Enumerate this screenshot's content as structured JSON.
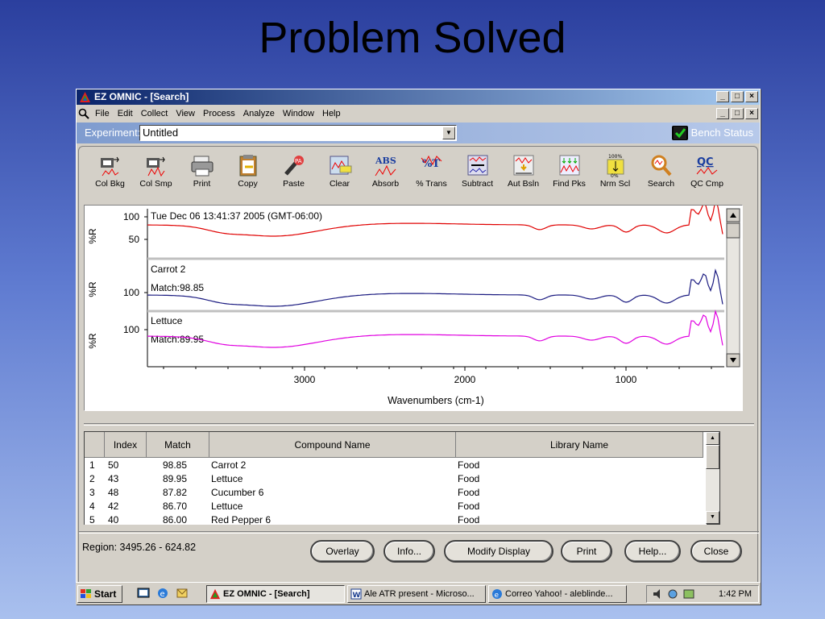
{
  "slide": {
    "title": "Problem Solved"
  },
  "window": {
    "title": "EZ OMNIC - [Search]",
    "buttons": [
      "_",
      "□",
      "×"
    ]
  },
  "menu": {
    "items": [
      "File",
      "Edit",
      "Collect",
      "View",
      "Process",
      "Analyze",
      "Window",
      "Help"
    ]
  },
  "experiment": {
    "label": "Experiment:",
    "value": "Untitled",
    "bench_status": "Bench Status"
  },
  "toolbar": {
    "buttons": [
      "Col Bkg",
      "Col Smp",
      "Print",
      "Copy",
      "Paste",
      "Clear",
      "Absorb",
      "% Trans",
      "Subtract",
      "Aut Bsln",
      "Find Pks",
      "Nrm Scl",
      "Search",
      "QC Cmp"
    ]
  },
  "spectra": {
    "panes": [
      {
        "ylabel": "%R",
        "ticks": [
          "100",
          "50"
        ],
        "title": "Tue Dec 06 13:41:37 2005 (GMT-06:00)",
        "subtitle": "",
        "color": "#e00000"
      },
      {
        "ylabel": "%R",
        "ticks": [
          "100"
        ],
        "title": "Carrot 2",
        "subtitle": "Match:98.85",
        "color": "#1a1a80"
      },
      {
        "ylabel": "%R",
        "ticks": [
          "100"
        ],
        "title": "Lettuce",
        "subtitle": "Match:89.95",
        "color": "#e000e0"
      }
    ],
    "x_ticks": [
      "3000",
      "2000",
      "1000"
    ],
    "x_label": "Wavenumbers (cm-1)"
  },
  "results": {
    "columns": [
      "Index",
      "Match",
      "Compound Name",
      "Library Name"
    ],
    "rows": [
      {
        "n": "1",
        "index": "50",
        "match": "98.85",
        "name": "Carrot 2",
        "library": "Food"
      },
      {
        "n": "2",
        "index": "43",
        "match": "89.95",
        "name": "Lettuce",
        "library": "Food"
      },
      {
        "n": "3",
        "index": "48",
        "match": "87.82",
        "name": "Cucumber 6",
        "library": "Food"
      },
      {
        "n": "4",
        "index": "42",
        "match": "86.70",
        "name": "Lettuce",
        "library": "Food"
      },
      {
        "n": "5",
        "index": "40",
        "match": "86.00",
        "name": "Red Pepper 6",
        "library": "Food"
      }
    ]
  },
  "footer": {
    "region": "Region:  3495.26  -  624.82",
    "buttons": [
      "Overlay",
      "Info...",
      "Modify Display",
      "Print",
      "Help...",
      "Close"
    ]
  },
  "taskbar": {
    "start": "Start",
    "tasks": [
      "EZ OMNIC - [Search]",
      "Ale ATR present - Microso...",
      "Correo Yahoo! - aleblinde..."
    ],
    "clock": "1:42 PM"
  }
}
